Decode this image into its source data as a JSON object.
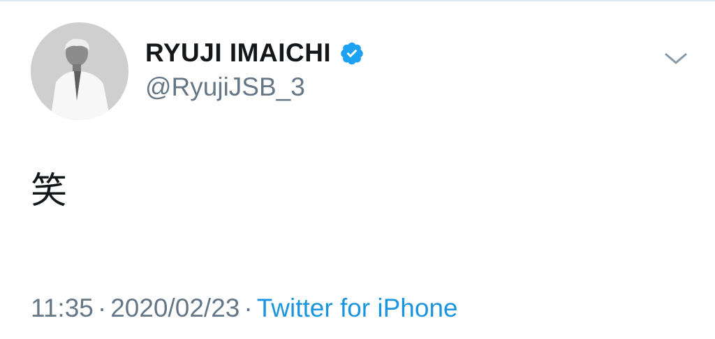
{
  "tweet": {
    "author": {
      "display_name": "RYUJI IMAICHI",
      "handle": "@RyujiJSB_3",
      "verified": true
    },
    "text": "笑",
    "time": "11:35",
    "date": "2020/02/23",
    "separator": "·",
    "source": "Twitter for iPhone"
  },
  "icons": {
    "verified": "verified-badge-icon",
    "menu": "chevron-down-icon"
  },
  "colors": {
    "verified_blue": "#1da1f2",
    "link_blue": "#1b95e0",
    "secondary_gray": "#657786",
    "primary_text": "#14171a"
  }
}
